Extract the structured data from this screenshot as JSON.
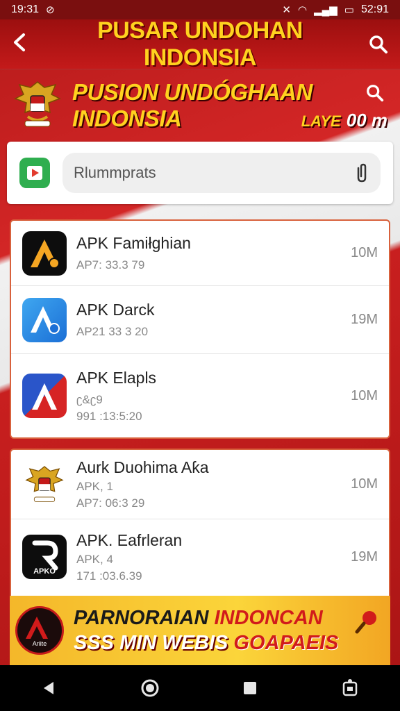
{
  "status_bar": {
    "time_left": "19:31",
    "time_right": "52:91"
  },
  "app_bar": {
    "title": "PUSAR UNDOHAN INDONSIA"
  },
  "banner": {
    "title_line1": "PUSION UNDÓGHAAN",
    "title_line2": "INDONSIA",
    "meta_label": "LAYE",
    "meta_value": "00 m"
  },
  "search": {
    "placeholder": "Rlummprats"
  },
  "list_top": [
    {
      "name": "APK Famiłghian",
      "sub1": "AP7: 33.3 79",
      "sub2": "",
      "size": "10M",
      "icon": "app-a-orange-icon"
    },
    {
      "name": "APK Darck",
      "sub1": "AP21 33 3 20",
      "sub2": "",
      "size": "19M",
      "icon": "app-a-blue-icon"
    },
    {
      "name": "APK Elapls",
      "sub1": "ʗ&ʗ9",
      "sub2": "991 :13:5:20",
      "size": "10M",
      "icon": "app-a-flag-icon"
    }
  ],
  "list_bottom": [
    {
      "name": "Aurk Duohima Aƙa",
      "sub1": "APK, 1",
      "sub2": "AP7: 06:3 29",
      "size": "10M",
      "icon": "garuda-icon"
    },
    {
      "name": "APK. Eafrleran",
      "sub1": "APK, 4",
      "sub2": "171 :03.6.39",
      "size": "19M",
      "icon": "app-r-black-icon"
    }
  ],
  "promo": {
    "line1_a": "PARNORAIAN",
    "line1_b": "INDONCAN",
    "line2_a": "SSS MIN WEBIS",
    "line2_b": "GOAPAEIS",
    "logo_text": "Ariite"
  },
  "icon_logo_texts": {
    "r_icon_label": "APKO"
  },
  "colors": {
    "accent_red": "#c41a1a",
    "accent_yellow": "#ffd21f",
    "card_border": "#d8613c"
  }
}
